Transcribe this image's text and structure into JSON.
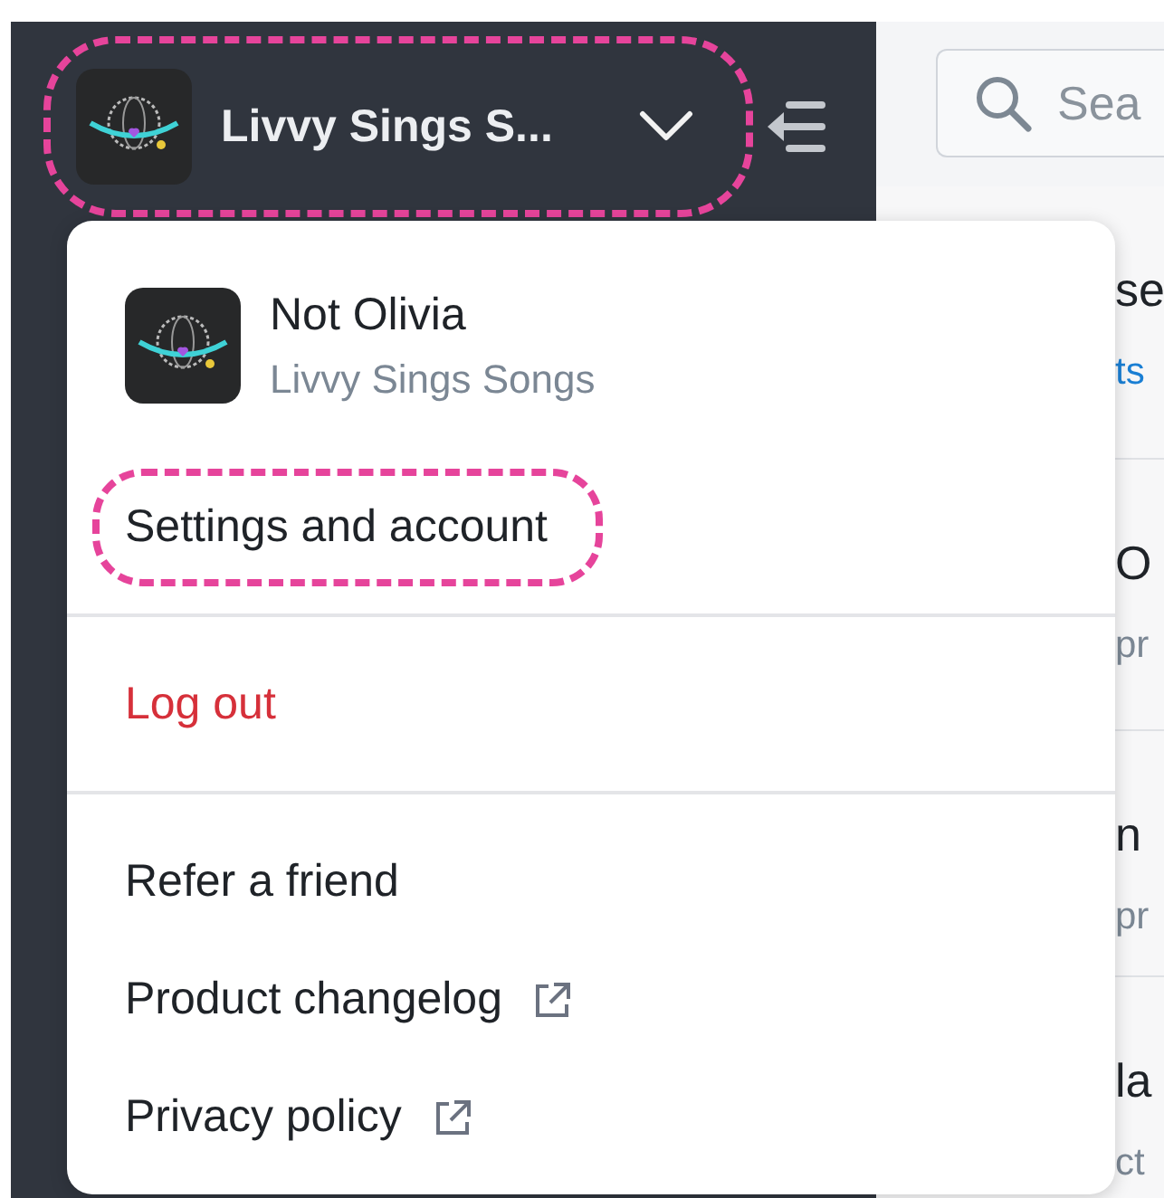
{
  "workspace_switcher": {
    "name": "Livvy Sings S...",
    "highlighted": true
  },
  "search": {
    "placeholder": "Sea"
  },
  "background_rows": [
    {
      "title": "se",
      "subtitle": "ts",
      "kind": "link"
    },
    {
      "title": "O",
      "subtitle": "pr",
      "kind": "plain"
    },
    {
      "title": "n",
      "subtitle": "pr",
      "kind": "plain"
    },
    {
      "title": "la",
      "subtitle": "ct",
      "kind": "plain"
    }
  ],
  "account_menu": {
    "user_name": "Not Olivia",
    "workspace": "Livvy Sings Songs",
    "sections": [
      [
        {
          "label": "Settings and account",
          "kind": "plain",
          "highlighted": true
        }
      ],
      [
        {
          "label": "Log out",
          "kind": "danger",
          "highlighted": false
        }
      ],
      [
        {
          "label": "Refer a friend",
          "kind": "plain",
          "highlighted": false
        },
        {
          "label": "Product changelog",
          "kind": "external",
          "highlighted": false
        },
        {
          "label": "Privacy policy",
          "kind": "external",
          "highlighted": false
        }
      ]
    ]
  }
}
